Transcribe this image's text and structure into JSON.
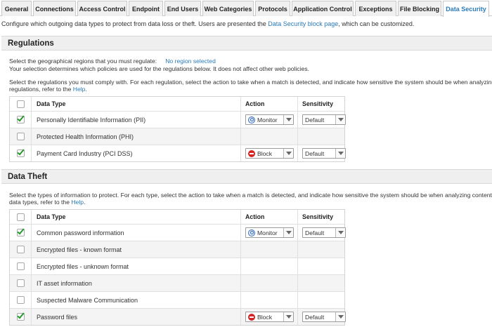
{
  "tabs": [
    {
      "label": "General",
      "active": false
    },
    {
      "label": "Connections",
      "active": false
    },
    {
      "label": "Access Control",
      "active": false
    },
    {
      "label": "Endpoint",
      "active": false
    },
    {
      "label": "End Users",
      "active": false
    },
    {
      "label": "Web Categories",
      "active": false
    },
    {
      "label": "Protocols",
      "active": false
    },
    {
      "label": "Application Control",
      "active": false
    },
    {
      "label": "Exceptions",
      "active": false
    },
    {
      "label": "File Blocking",
      "active": false
    },
    {
      "label": "Data Security",
      "active": true
    }
  ],
  "intro": {
    "prefix": "Configure which outgoing data types to protect from data loss or theft. Users are presented the ",
    "link": "Data Security block page",
    "suffix": ", which can be customized."
  },
  "regulations": {
    "title": "Regulations",
    "region_prompt": "Select the geographical regions that you must regulate:",
    "region_link": "No region selected",
    "region_note": "Your selection determines which policies are used for the regulations below. It does not affect other web policies.",
    "desc_line1": "Select the regulations you must comply with. For each regulation, select the action to take when a match is detected, and indicate how sensitive the system should be when analyzing c",
    "desc_line2_prefix": "regulations, refer to the ",
    "desc_line2_link": "Help",
    "desc_line2_suffix": ".",
    "columns": {
      "data_type": "Data Type",
      "action": "Action",
      "sensitivity": "Sensitivity"
    },
    "rows": [
      {
        "checked": true,
        "name": "Personally Identifiable Information (PII)",
        "action": "Monitor",
        "action_icon": "monitor-icon",
        "sensitivity": "Default"
      },
      {
        "checked": false,
        "name": "Protected Health Information (PHI)",
        "action": "",
        "action_icon": "",
        "sensitivity": ""
      },
      {
        "checked": true,
        "name": "Payment Card Industry (PCI DSS)",
        "action": "Block",
        "action_icon": "block-icon",
        "sensitivity": "Default"
      }
    ]
  },
  "data_theft": {
    "title": "Data Theft",
    "desc_line1": "Select the types of information to protect. For each type, select the action to take when a match is detected, and indicate how sensitive the system should be when analyzing content. F",
    "desc_line2_prefix": "data types, refer to the ",
    "desc_line2_link": "Help",
    "desc_line2_suffix": ".",
    "columns": {
      "data_type": "Data Type",
      "action": "Action",
      "sensitivity": "Sensitivity"
    },
    "rows": [
      {
        "checked": true,
        "name": "Common password information",
        "action": "Monitor",
        "action_icon": "monitor-icon",
        "sensitivity": "Default"
      },
      {
        "checked": false,
        "name": "Encrypted files - known format",
        "action": "",
        "action_icon": "",
        "sensitivity": ""
      },
      {
        "checked": false,
        "name": "Encrypted files - unknown format",
        "action": "",
        "action_icon": "",
        "sensitivity": ""
      },
      {
        "checked": false,
        "name": "IT asset information",
        "action": "",
        "action_icon": "",
        "sensitivity": ""
      },
      {
        "checked": false,
        "name": "Suspected Malware Communication",
        "action": "",
        "action_icon": "",
        "sensitivity": ""
      },
      {
        "checked": true,
        "name": "Password files",
        "action": "Block",
        "action_icon": "block-icon",
        "sensitivity": "Default"
      }
    ]
  },
  "colors": {
    "link": "#2a7ab8",
    "check": "#1f9a2b",
    "block": "#d42424",
    "header_bg": "#efefef"
  }
}
